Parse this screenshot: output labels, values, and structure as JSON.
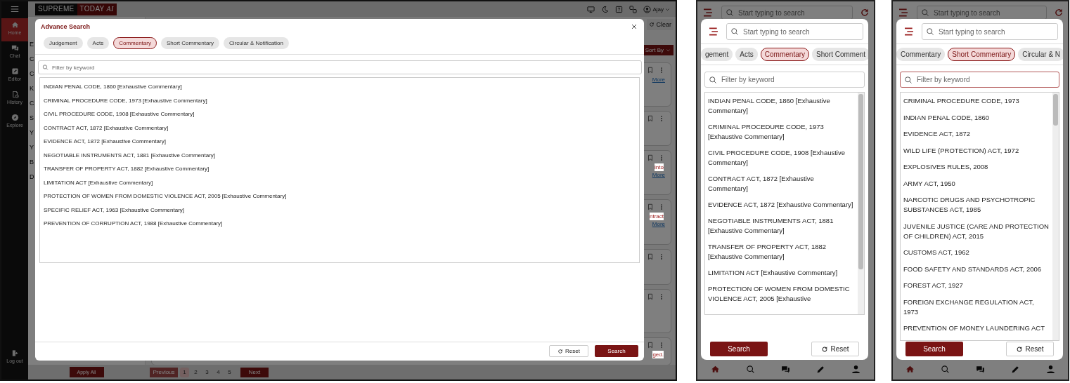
{
  "desktop": {
    "app": {
      "logo": {
        "primary": "SUPREME",
        "secondary": "TODAY",
        "suffix": "AI"
      },
      "nav": [
        {
          "kind": "home",
          "label": "Home",
          "selected": true
        },
        {
          "kind": "chat",
          "label": "Chat",
          "selected": false
        },
        {
          "kind": "editor",
          "label": "Editor",
          "selected": false
        },
        {
          "kind": "history",
          "label": "History",
          "selected": false
        },
        {
          "kind": "explore",
          "label": "Explore",
          "selected": false
        }
      ],
      "logout": "Log out",
      "header_icons": [
        {
          "kind": "monitor"
        },
        {
          "kind": "moon"
        },
        {
          "kind": "help"
        },
        {
          "kind": "translate"
        }
      ],
      "user": "Ajay",
      "clear_button": "Clear",
      "sort_button": "Sort By",
      "filter_labels": [
        "E",
        "C",
        "C",
        "K",
        "C",
        "S",
        "Y",
        "Y",
        "B",
        "D"
      ],
      "cards": [
        {
          "kind": "link",
          "link": "More"
        },
        {
          "kind": "plain"
        },
        {
          "kind": "snippet",
          "snippet": "into",
          "link": "More"
        },
        {
          "kind": "snippet",
          "snippet": "ntract",
          "link": "More"
        },
        {
          "kind": "plain"
        },
        {
          "kind": "plain"
        },
        {
          "kind": "snippet",
          "snippet": "ged."
        }
      ],
      "apply_button": "Apply All",
      "pagination": {
        "previous": {
          "label": "Previous",
          "disabled": true
        },
        "pages": [
          {
            "label": "1",
            "selected": true
          },
          {
            "label": "2",
            "selected": false
          },
          {
            "label": "3",
            "selected": false
          },
          {
            "label": "4",
            "selected": false
          },
          {
            "label": "5",
            "selected": false
          }
        ],
        "next": {
          "label": "Next",
          "disabled": false
        }
      }
    },
    "modal": {
      "title": "Advance Search",
      "tabs": [
        {
          "label": "Judgement",
          "selected": false
        },
        {
          "label": "Acts",
          "selected": false
        },
        {
          "label": "Commentary",
          "selected": true
        },
        {
          "label": "Short Commentary",
          "selected": false
        },
        {
          "label": "Circular & Notification",
          "selected": false
        }
      ],
      "filter": {
        "placeholder": "Filter by keyword",
        "focused": false
      },
      "items": [
        "INDIAN PENAL CODE, 1860 [Exhaustive Commentary]",
        "CRIMINAL PROCEDURE CODE, 1973 [Exhaustive Commentary]",
        "CIVIL PROCEDURE CODE, 1908 [Exhaustive Commentary]",
        "CONTRACT ACT, 1872 [Exhaustive Commentary]",
        "EVIDENCE ACT, 1872 [Exhaustive Commentary]",
        "NEGOTIABLE INSTRUMENTS ACT, 1881 [Exhaustive Commentary]",
        "TRANSFER OF PROPERTY ACT, 1882 [Exhaustive Commentary]",
        "LIMITATION ACT [Exhaustive Commentary]",
        "PROTECTION OF WOMEN FROM DOMESTIC VIOLENCE ACT, 2005 [Exhaustive Commentary]",
        "SPECIFIC RELIEF ACT, 1963 [Exhaustive Commentary]",
        "PREVENTION OF CORRUPTION ACT, 1988 [Exhaustive Commentary]"
      ],
      "reset_button": "Reset",
      "search_button": "Search"
    }
  },
  "mobile_views": [
    {
      "app": {
        "search_placeholder": "Start typing to search",
        "bottom_nav": [
          {
            "kind": "home",
            "selected": true
          },
          {
            "kind": "search",
            "selected": false
          },
          {
            "kind": "chat",
            "selected": false
          },
          {
            "kind": "pencil",
            "selected": false
          },
          {
            "kind": "person",
            "selected": false
          }
        ]
      },
      "modal": {
        "search_placeholder": "Start typing to search",
        "tabs": [
          {
            "label": "gement",
            "selected": false
          },
          {
            "label": "Acts",
            "selected": false
          },
          {
            "label": "Commentary",
            "selected": true
          },
          {
            "label": "Short Comment",
            "selected": false
          }
        ],
        "filter": {
          "placeholder": "Filter by keyword",
          "focused": false
        },
        "items": [
          "INDIAN PENAL CODE, 1860 [Exhaustive Commentary]",
          "CRIMINAL PROCEDURE CODE, 1973 [Exhaustive Commentary]",
          "CIVIL PROCEDURE CODE, 1908 [Exhaustive Commentary]",
          "CONTRACT ACT, 1872 [Exhaustive Commentary]",
          "EVIDENCE ACT, 1872 [Exhaustive Commentary]",
          "NEGOTIABLE INSTRUMENTS ACT, 1881 [Exhaustive Commentary]",
          "TRANSFER OF PROPERTY ACT, 1882 [Exhaustive Commentary]",
          "LIMITATION ACT [Exhaustive Commentary]",
          "PROTECTION OF WOMEN FROM DOMESTIC VIOLENCE ACT, 2005 [Exhaustive"
        ],
        "search_button": "Search",
        "reset_button": "Reset"
      }
    },
    {
      "app": {
        "search_placeholder": "Start typing to search",
        "bottom_nav": [
          {
            "kind": "home",
            "selected": true
          },
          {
            "kind": "search",
            "selected": false
          },
          {
            "kind": "chat",
            "selected": false
          },
          {
            "kind": "pencil",
            "selected": false
          },
          {
            "kind": "person",
            "selected": false
          }
        ]
      },
      "modal": {
        "search_placeholder": "Start typing to search",
        "tabs": [
          {
            "label": "Commentary",
            "selected": false
          },
          {
            "label": "Short Commentary",
            "selected": true
          },
          {
            "label": "Circular & N",
            "selected": false
          }
        ],
        "filter": {
          "placeholder": "Filter by keyword",
          "focused": true
        },
        "items": [
          "CRIMINAL PROCEDURE CODE, 1973",
          "INDIAN PENAL CODE, 1860",
          "EVIDENCE ACT, 1872",
          "WILD LIFE (PROTECTION) ACT, 1972",
          "EXPLOSIVES RULES, 2008",
          "ARMY ACT, 1950",
          "NARCOTIC DRUGS AND PSYCHOTROPIC SUBSTANCES ACT, 1985",
          "JUVENILE JUSTICE (CARE AND PROTECTION OF CHILDREN) ACT, 2015",
          "CUSTOMS ACT, 1962",
          "FOOD SAFETY AND STANDARDS ACT, 2006",
          "FOREST ACT, 1927",
          "FOREIGN EXCHANGE REGULATION ACT, 1973",
          "PREVENTION OF MONEY LAUNDERING ACT"
        ],
        "search_button": "Search",
        "reset_button": "Reset"
      }
    }
  ]
}
